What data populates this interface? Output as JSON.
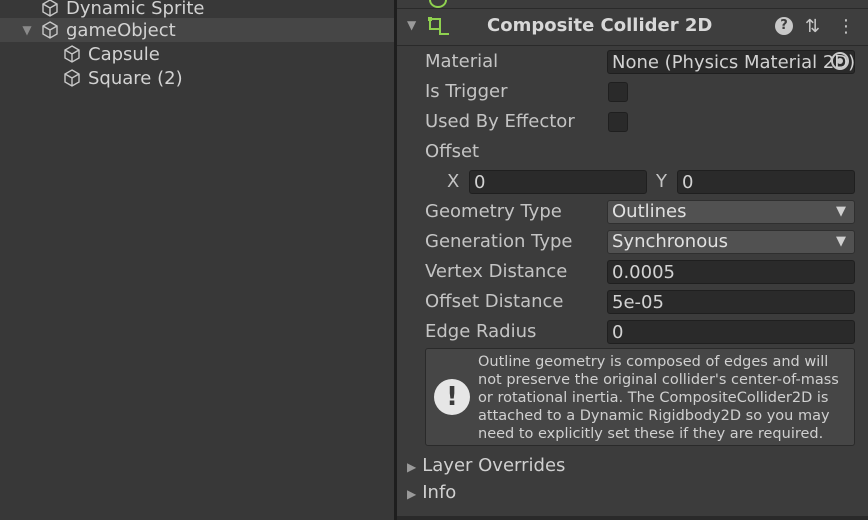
{
  "hierarchy": {
    "items": [
      {
        "label": "Dynamic Sprite",
        "icon": "cube-icon"
      },
      {
        "label": "gameObject",
        "icon": "cube-icon",
        "expanded": true
      },
      {
        "label": "Capsule",
        "icon": "cube-icon"
      },
      {
        "label": "Square (2)",
        "icon": "cube-icon"
      }
    ],
    "fold_glyph": "▼"
  },
  "component": {
    "title": "Composite Collider 2D",
    "fold_glyph": "▼",
    "help_glyph": "?",
    "settings_glyph": "⇅",
    "menu_glyph": "⋮",
    "accent": "#8fd14f"
  },
  "props": {
    "material_label": "Material",
    "material_value": "None (Physics Material 2D)",
    "is_trigger_label": "Is Trigger",
    "used_by_effector_label": "Used By Effector",
    "offset_label": "Offset",
    "offset_x_label": "X",
    "offset_x_value": "0",
    "offset_y_label": "Y",
    "offset_y_value": "0",
    "geometry_type_label": "Geometry Type",
    "geometry_type_value": "Outlines",
    "generation_type_label": "Generation Type",
    "generation_type_value": "Synchronous",
    "vertex_distance_label": "Vertex Distance",
    "vertex_distance_value": "0.0005",
    "offset_distance_label": "Offset Distance",
    "offset_distance_value": "5e-05",
    "edge_radius_label": "Edge Radius",
    "edge_radius_value": "0",
    "dropdown_glyph": "▼"
  },
  "help": {
    "icon_glyph": "!",
    "text": "Outline geometry is composed of edges and will not preserve the original collider's center-of-mass or rotational inertia.  The CompositeCollider2D is attached to a Dynamic Rigidbody2D so you may need to explicitly set these if they are required."
  },
  "foldouts": {
    "glyph": "▶",
    "layer_overrides": "Layer Overrides",
    "info": "Info"
  }
}
